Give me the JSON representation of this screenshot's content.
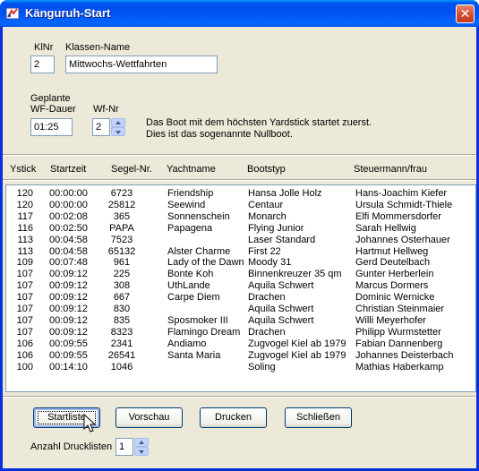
{
  "window": {
    "title": "Känguruh-Start"
  },
  "form": {
    "klnr_label": "KlNr",
    "klnr_value": "2",
    "klassen_name_label": "Klassen-Name",
    "klassen_name_value": "Mittwochs-Wettfahrten",
    "geplante_label": "Geplante",
    "wf_dauer_label": "WF-Dauer",
    "wf_dauer_value": "01:25",
    "wfnr_label": "Wf-Nr",
    "wfnr_value": "2",
    "info_line1": "Das Boot mit dem höchsten Yardstick startet zuerst.",
    "info_line2": "Dies ist das sogenannte Nullboot."
  },
  "table": {
    "headers": [
      "Ystick",
      "Startzeit",
      "Segel-Nr.",
      "Yachtname",
      "Bootstyp",
      "Steuermann/frau"
    ],
    "rows": [
      [
        "120",
        "00:00:00",
        "6723",
        "Friendship",
        "Hansa Jolle Holz",
        "Hans-Joachim Kiefer"
      ],
      [
        "120",
        "00:00:00",
        "25812",
        "Seewind",
        "Centaur",
        "Ursula Schmidt-Thiele"
      ],
      [
        "117",
        "00:02:08",
        "365",
        "Sonnenschein",
        "Monarch",
        "Elfi Mommersdorfer"
      ],
      [
        "116",
        "00:02:50",
        "PAPA",
        "Papagena",
        "Flying Junior",
        "Sarah Hellwig"
      ],
      [
        "113",
        "00:04:58",
        "7523",
        "",
        "Laser Standard",
        "Johannes Osterhauer"
      ],
      [
        "113",
        "00:04:58",
        "65132",
        "Alster Charme",
        "First 22",
        "Hartmut Hellweg"
      ],
      [
        "109",
        "00:07:48",
        "961",
        "Lady of the Dawn",
        "Moody 31",
        "Gerd Deutelbach"
      ],
      [
        "107",
        "00:09:12",
        "225",
        "Bonte Koh",
        "Binnenkreuzer 35 qm",
        "Gunter Herberlein"
      ],
      [
        "107",
        "00:09:12",
        "308",
        "UthLande",
        "Aquila Schwert",
        "Marcus Dormers"
      ],
      [
        "107",
        "00:09:12",
        "667",
        "Carpe Diem",
        "Drachen",
        "Dominic Wernicke"
      ],
      [
        "107",
        "00:09:12",
        "830",
        "",
        "Aquila Schwert",
        "Christian Steinmaier"
      ],
      [
        "107",
        "00:09:12",
        "835",
        "Sposmoker III",
        "Aquila Schwert",
        "Willi Meyerhofer"
      ],
      [
        "107",
        "00:09:12",
        "8323",
        "Flamingo Dream",
        "Drachen",
        "Philipp Wurmstetter"
      ],
      [
        "106",
        "00:09:55",
        "2341",
        "Andiamo",
        "Zugvogel Kiel ab 1979",
        "Fabian Dannenberg"
      ],
      [
        "106",
        "00:09:55",
        "26541",
        "Santa Maria",
        "Zugvogel Kiel ab 1979",
        "Johannes Deisterbach"
      ],
      [
        "100",
        "00:14:10",
        "1046",
        "",
        "Soling",
        "Mathias Haberkamp"
      ]
    ]
  },
  "buttons": {
    "startliste": "Startliste",
    "vorschau": "Vorschau",
    "drucken": "Drucken",
    "schliessen": "Schließen"
  },
  "print": {
    "anzahl_label": "Anzahl Drucklisten",
    "anzahl_value": "1"
  },
  "icons": {
    "app": "kangaroo-app-icon",
    "close": "close-icon",
    "spin": "spinner-arrows-icon",
    "cursor": "mouse-pointer-icon"
  }
}
